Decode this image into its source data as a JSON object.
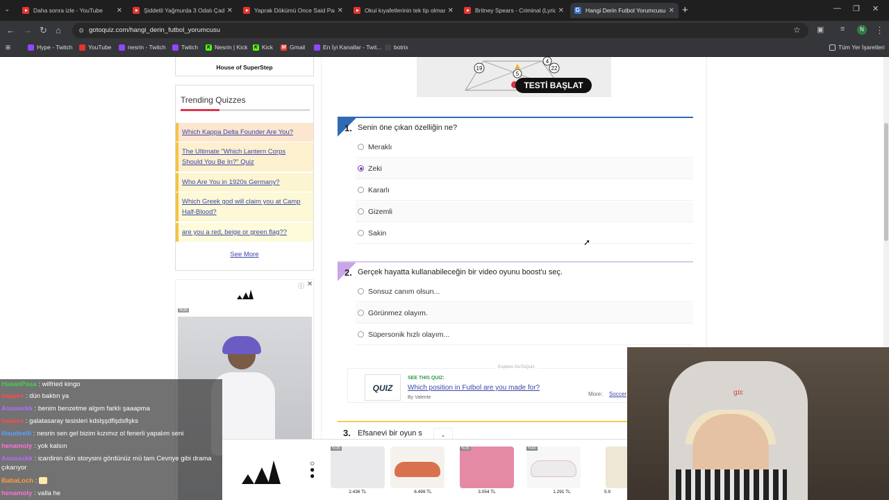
{
  "browser": {
    "tabs": [
      {
        "title": "Daha sonra izle - YouTube",
        "icon": "youtube-icon"
      },
      {
        "title": "Şiddetli Yağmurda 3 Odalı Çad",
        "icon": "youtube-icon"
      },
      {
        "title": "Yaprak Dökümü Once Said Parti",
        "icon": "youtube-icon"
      },
      {
        "title": "Okul kıyafetlerinin tek tip olmas",
        "icon": "youtube-icon"
      },
      {
        "title": "Britney Spears - Criminal (Lyrics",
        "icon": "youtube-icon"
      },
      {
        "title": "Hangi Derin Futbol Yorumcusu",
        "icon": "gotoquiz-icon"
      }
    ],
    "url": "gotoquiz.com/hangi_derin_futbol_yorumcusu",
    "bookmarks": [
      "Hype - Twitch",
      "YouTube",
      "nesrin - Twitch",
      "Twitch",
      "Nesrin | Kick",
      "Kick",
      "Gmail",
      "En İyi Kanallar - Twit...",
      "botrix"
    ],
    "all_bookmarks": "Tüm Yer İşaretleri",
    "profile_initial": "N"
  },
  "sidebar": {
    "house_label": "House of SuperStep",
    "trending_title": "Trending Quizzes",
    "trending": [
      "Which Kappa Delta Founder Are You?",
      "The Ultimate \"Which Lantern Corps Should You Be In?\" Quiz",
      "Who Are You in 1920s Germany?",
      "Which Greek god will claim you at Camp Half-Blood?",
      "are you a red, beige or green flag??"
    ],
    "see_more": "See More",
    "ad_badge": "%35"
  },
  "quiz": {
    "start_button": "TESTİ BAŞLAT",
    "diagram_numbers": [
      "19",
      "5",
      "4",
      "22"
    ],
    "questions": [
      {
        "num": "1.",
        "text": "Senin öne çıkan özelliğin ne?",
        "options": [
          "Meraklı",
          "Zeki",
          "Kararlı",
          "Gizemli",
          "Sakin"
        ],
        "selected": 1
      },
      {
        "num": "2.",
        "text": "Gerçek hayatta kullanabileceğin bir video oyunu boost'u seç.",
        "options": [
          "Sonsuz canım olsun...",
          "Görünmez olayım.",
          "Süpersonik hızlı olayım..."
        ],
        "selected": -1
      }
    ],
    "q3_num": "3.",
    "q3_text": "Efsanevi bir oyun s"
  },
  "see_quiz": {
    "explore": "Explore GoToQuiz",
    "logo": "QUIZ",
    "label": "SEE THIS QUIZ:",
    "title": "Which position in Futbol are you made for?",
    "by": "By Valente",
    "more": "More:",
    "more_link": "Soccer"
  },
  "ad_strip": {
    "products": [
      {
        "badge": "%35",
        "price": "2.436 TL",
        "color": "#e9e9ec"
      },
      {
        "badge": "",
        "price": "6.499 TL",
        "color": "#d9714f"
      },
      {
        "badge": "%35",
        "price": "3.054 TL",
        "color": "#e58aa5"
      },
      {
        "badge": "%40",
        "price": "1.291 TL",
        "color": "#ececec"
      },
      {
        "badge": "",
        "price": "5.9",
        "color": "#efe7d6"
      }
    ]
  },
  "chat": [
    {
      "user": "HasanPasa",
      "msg": "wilfried kingo",
      "color": "#3fd24a"
    },
    {
      "user": "baaaev",
      "msg": "dün baktın ya",
      "color": "#ff4b4b"
    },
    {
      "user": "Asunaxkk",
      "msg": "benim benzetme algım farklı şaaapma",
      "color": "#b26dff"
    },
    {
      "user": "baaaev",
      "msg": "galatasaray tesisleri kdslşşdflşdsflşks",
      "color": "#ff4b4b"
    },
    {
      "user": "illsudeelli",
      "msg": "nesrin sen gel bizim kızımız ol fenerli yapalım seni",
      "color": "#5aa0ff"
    },
    {
      "user": "henamoly",
      "msg": "yok kalsın",
      "color": "#ff6fd8"
    },
    {
      "user": "Asunaxkk",
      "msg": "icardinin dün storysini gördünüz mü tam Cevriye gibi drama çıkarıyor",
      "color": "#b26dff"
    },
    {
      "user": "BabaLoch",
      "msg": "",
      "color": "#ff9a3c"
    },
    {
      "user": "henamoly",
      "msg": "valla he",
      "color": "#ff6fd8"
    }
  ],
  "cam": {
    "chair_text": "ɡɪɛ"
  }
}
